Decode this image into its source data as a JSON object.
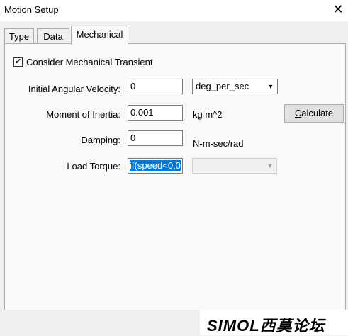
{
  "window": {
    "title": "Motion Setup",
    "close_glyph": "✕"
  },
  "tabs": [
    {
      "label": "Type",
      "active": false
    },
    {
      "label": "Data",
      "active": false
    },
    {
      "label": "Mechanical",
      "active": true
    }
  ],
  "mechanical": {
    "consider_transient": {
      "label": "Consider Mechanical Transient",
      "checked": true,
      "glyph": "✔"
    },
    "initial_angular_velocity": {
      "label": "Initial Angular Velocity:",
      "value": "0",
      "unit": "deg_per_sec"
    },
    "moment_of_inertia": {
      "label": "Moment of Inertia:",
      "value": "0.001",
      "unit": "kg m^2"
    },
    "calculate_button": {
      "label_underlined": "C",
      "label_rest": "alculate"
    },
    "damping": {
      "label": "Damping:",
      "value": "0",
      "unit": "N-m-sec/rad"
    },
    "load_torque": {
      "label": "Load Torque:",
      "value": "if(speed<0,0",
      "unit": ""
    }
  },
  "watermark": {
    "text": "SIMOL西莫论坛"
  }
}
